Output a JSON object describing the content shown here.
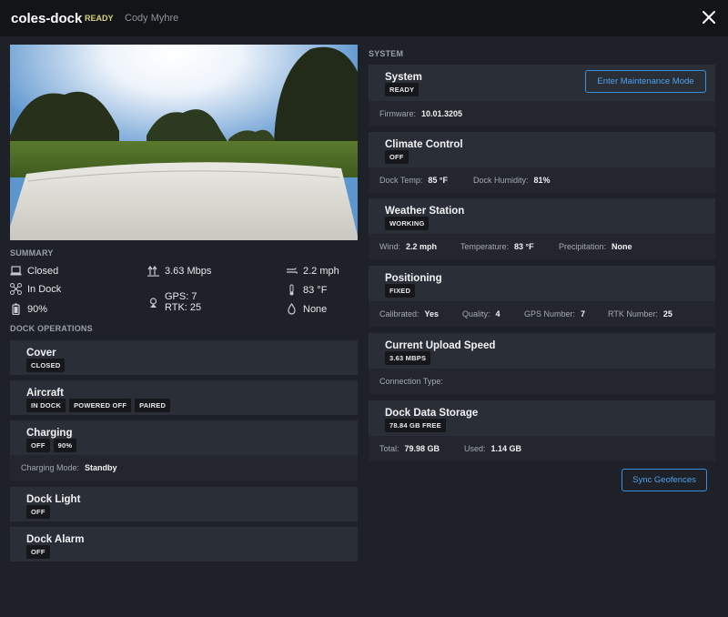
{
  "header": {
    "name": "coles-dock",
    "status": "READY",
    "user": "Cody Myhre"
  },
  "summary": {
    "heading": "SUMMARY",
    "cover": "Closed",
    "bandwidth": "3.63 Mbps",
    "wind": "2.2 mph",
    "aircraft": "In Dock",
    "temperature": "83 °F",
    "gps": "GPS: 7",
    "rtk": "RTK: 25",
    "battery": "90%",
    "precip": "None"
  },
  "dock_ops": {
    "heading": "DOCK OPERATIONS",
    "cover": {
      "title": "Cover",
      "badges": [
        "CLOSED"
      ]
    },
    "aircraft": {
      "title": "Aircraft",
      "badges": [
        "IN DOCK",
        "POWERED OFF",
        "PAIRED"
      ]
    },
    "charging": {
      "title": "Charging",
      "badges": [
        "OFF",
        "90%"
      ],
      "mode_label": "Charging Mode:",
      "mode_value": "Standby"
    },
    "light": {
      "title": "Dock Light",
      "badges": [
        "OFF"
      ]
    },
    "alarm": {
      "title": "Dock Alarm",
      "badges": [
        "OFF"
      ]
    }
  },
  "system": {
    "heading": "SYSTEM",
    "system": {
      "title": "System",
      "badge": "READY",
      "maint_btn": "Enter Maintenance Mode",
      "fw_label": "Firmware:",
      "fw_value": "10.01.3205"
    },
    "climate": {
      "title": "Climate Control",
      "badge": "OFF",
      "temp_label": "Dock Temp:",
      "temp_value": "85 °F",
      "hum_label": "Dock Humidity:",
      "hum_value": "81%"
    },
    "weather": {
      "title": "Weather Station",
      "badge": "WORKING",
      "wind_label": "Wind:",
      "wind_value": "2.2 mph",
      "temp_label": "Temperature:",
      "temp_value": "83 °F",
      "precip_label": "Precipitation:",
      "precip_value": "None"
    },
    "positioning": {
      "title": "Positioning",
      "badge": "FIXED",
      "cal_label": "Calibrated:",
      "cal_value": "Yes",
      "q_label": "Quality:",
      "q_value": "4",
      "gps_label": "GPS Number:",
      "gps_value": "7",
      "rtk_label": "RTK Number:",
      "rtk_value": "25"
    },
    "upload": {
      "title": "Current Upload Speed",
      "badge": "3.63 MBPS",
      "conn_label": "Connection Type:"
    },
    "storage": {
      "title": "Dock Data Storage",
      "badge": "78.84 GB FREE",
      "total_label": "Total:",
      "total_value": "79.98 GB",
      "used_label": "Used:",
      "used_value": "1.14 GB"
    },
    "sync_btn": "Sync Geofences"
  }
}
